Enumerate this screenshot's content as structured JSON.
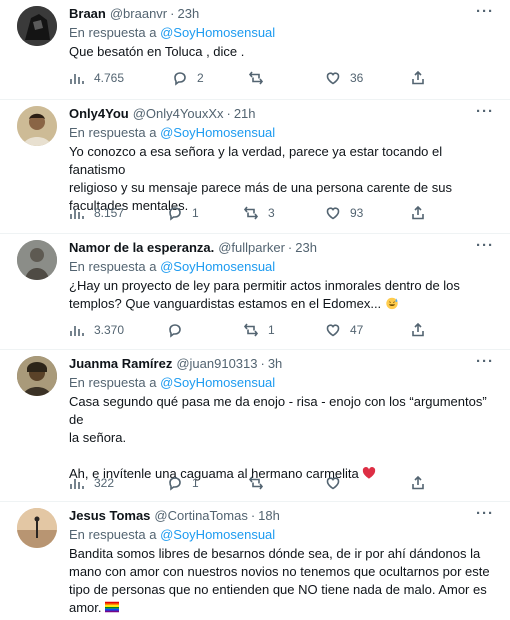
{
  "tweets": [
    {
      "name": "Braan",
      "handle": "@braanvr",
      "time": "23h",
      "reply_prefix": "En respuesta a",
      "reply_to": "@SoyHomosensual",
      "text": [
        "Que besatón en Toluca , dice ."
      ],
      "views": "4.765",
      "replies": "2",
      "retweets": "",
      "likes": "36",
      "avatar_color": "#2a2a2a"
    },
    {
      "name": "Only4You",
      "handle": "@Only4YouxXx",
      "time": "21h",
      "reply_prefix": "En respuesta a",
      "reply_to": "@SoyHomosensual",
      "text": [
        "Yo conozco a esa señora y la verdad, parece ya estar tocando el fanatismo",
        "religioso y su mensaje parece más de una persona carente de sus",
        "facultades mentales."
      ],
      "views": "8.157",
      "replies": "1",
      "retweets": "3",
      "likes": "93",
      "avatar_color": "#8a6a4a"
    },
    {
      "name": "Namor de la esperanza.",
      "handle": "@fullparker",
      "time": "23h",
      "reply_prefix": "En respuesta a",
      "reply_to": "@SoyHomosensual",
      "text": [
        "¿Hay un proyecto de ley para permitir actos inmorales dentro de los",
        "templos? Que vanguardistas estamos en el Edomex..."
      ],
      "views": "3.370",
      "replies": "",
      "retweets": "1",
      "likes": "47",
      "avatar_color": "#6d6f6a"
    },
    {
      "name": "Juanma Ramírez",
      "handle": "@juan910313",
      "time": "3h",
      "reply_prefix": "En respuesta a",
      "reply_to": "@SoyHomosensual",
      "text": [
        "Casa segundo qué pasa me da enojo - risa - enojo con los “argumentos” de",
        "la señora.",
        "",
        "Ah, e invítenle una caguama al hermano carmelita"
      ],
      "views": "322",
      "replies": "1",
      "retweets": "",
      "likes": "",
      "avatar_color": "#5a4e3a"
    },
    {
      "name": "Jesus Tomas",
      "handle": "@CortinaTomas",
      "time": "18h",
      "reply_prefix": "En respuesta a",
      "reply_to": "@SoyHomosensual",
      "text": [
        "Bandita somos libres de besarnos dónde sea, de ir por ahí dándonos la",
        "mano con amor con nuestros novios no tenemos que ocultarnos por este",
        "tipo de personas que no entienden que NO tiene nada de malo. Amor es",
        "amor."
      ],
      "views": "",
      "replies": "",
      "retweets": "",
      "likes": "",
      "avatar_color": "#c9a27a"
    }
  ]
}
